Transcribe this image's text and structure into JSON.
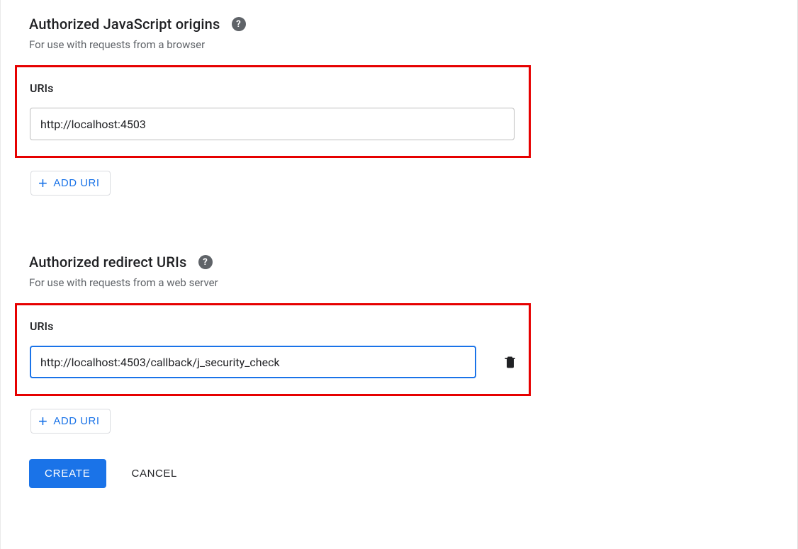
{
  "js_origins": {
    "title": "Authorized JavaScript origins",
    "description": "For use with requests from a browser",
    "uris_label": "URIs",
    "inputs": [
      {
        "value": "http://localhost:4503"
      }
    ],
    "add_label": "ADD URI"
  },
  "redirect_uris": {
    "title": "Authorized redirect URIs",
    "description": "For use with requests from a web server",
    "uris_label": "URIs",
    "inputs": [
      {
        "value": "http://localhost:4503/callback/j_security_check"
      }
    ],
    "add_label": "ADD URI"
  },
  "actions": {
    "create": "CREATE",
    "cancel": "CANCEL"
  },
  "icons": {
    "help": "?",
    "plus": "+"
  }
}
